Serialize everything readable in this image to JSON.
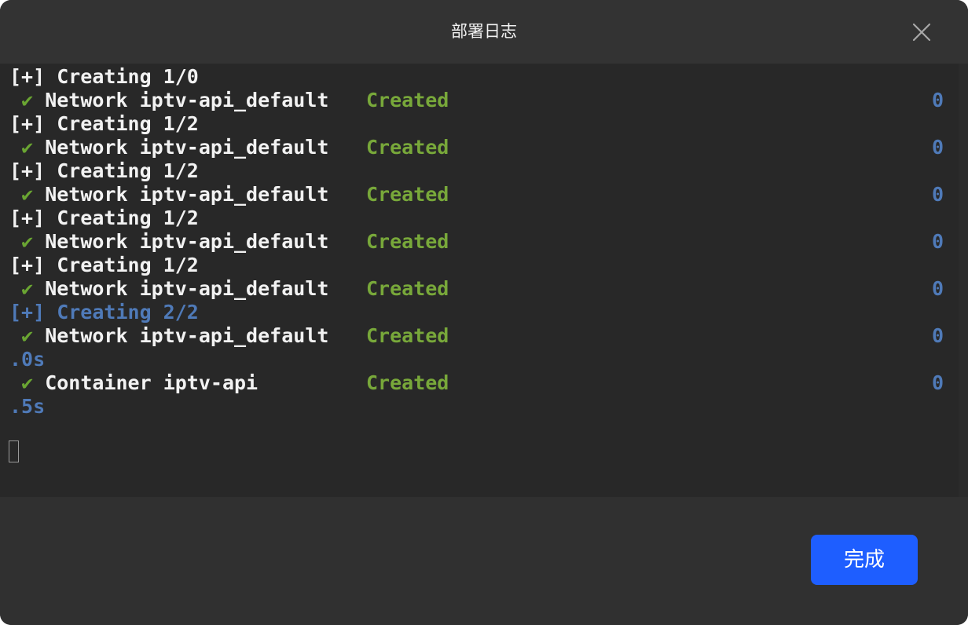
{
  "dialog": {
    "title": "部署日志",
    "close_icon": "close-icon",
    "done_label": "完成"
  },
  "log": {
    "lines": [
      {
        "text": "[+] Creating 1/0",
        "type": "header"
      },
      {
        "check": "✔",
        "text": "Network iptv-api_default",
        "status": "Created",
        "time": "0"
      },
      {
        "text": "[+] Creating 1/2",
        "type": "header"
      },
      {
        "check": "✔",
        "text": "Network iptv-api_default",
        "status": "Created",
        "time": "0"
      },
      {
        "text": "[+] Creating 1/2",
        "type": "header"
      },
      {
        "check": "✔",
        "text": "Network iptv-api_default",
        "status": "Created",
        "time": "0"
      },
      {
        "text": "[+] Creating 1/2",
        "type": "header"
      },
      {
        "check": "✔",
        "text": "Network iptv-api_default",
        "status": "Created",
        "time": "0"
      },
      {
        "text": "[+] Creating 1/2",
        "type": "header"
      },
      {
        "check": "✔",
        "text": "Network iptv-api_default",
        "status": "Created",
        "time": "0"
      },
      {
        "text": "[+] Creating 2/2",
        "type": "header-blue"
      },
      {
        "check": "✔",
        "text": "Network iptv-api_default",
        "status": "Created",
        "time": "0"
      },
      {
        "text": ".0s",
        "type": "time-wrap"
      },
      {
        "check": "✔",
        "text": "Container iptv-api",
        "status": "Created",
        "time": "0"
      },
      {
        "text": ".5s",
        "type": "time-wrap"
      }
    ]
  },
  "colors": {
    "background": "#282828",
    "text": "#f2f2f2",
    "check": "#6aa532",
    "status_created": "#78a83a",
    "time_blue": "#4f7ab8",
    "accent_button": "#1e5eff"
  }
}
